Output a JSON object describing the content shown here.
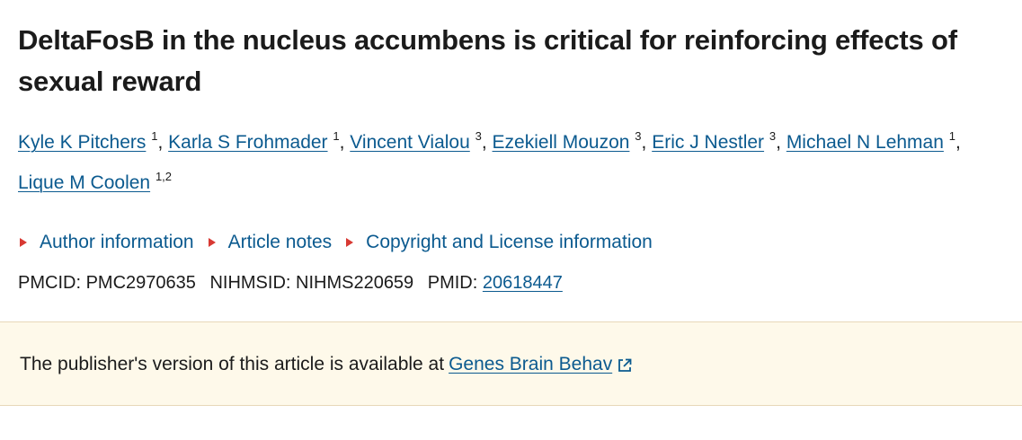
{
  "article": {
    "title": "DeltaFosB in the nucleus accumbens is critical for reinforcing effects of sexual reward"
  },
  "authors": [
    {
      "name": "Kyle K Pitchers",
      "aff": "1",
      "sep": ", "
    },
    {
      "name": "Karla S Frohmader",
      "aff": "1",
      "sep": ", "
    },
    {
      "name": "Vincent Vialou",
      "aff": "3",
      "sep": ", "
    },
    {
      "name": "Ezekiell Mouzon",
      "aff": "3",
      "sep": ", "
    },
    {
      "name": "Eric J Nestler",
      "aff": "3",
      "sep": ", "
    },
    {
      "name": "Michael N Lehman",
      "aff": "1",
      "sep": ","
    },
    {
      "name": "Lique M Coolen",
      "aff": "1,2",
      "sep": ""
    }
  ],
  "toggles": {
    "author_info": "Author information",
    "article_notes": "Article notes",
    "copyright": "Copyright and License information"
  },
  "ids": {
    "pmcid_label": "PMCID:",
    "pmcid_value": "PMC2970635",
    "nihmsid_label": "NIHMSID:",
    "nihmsid_value": "NIHMS220659",
    "pmid_label": "PMID:",
    "pmid_value": "20618447"
  },
  "publisher_banner": {
    "text": "The publisher's version of this article is available at",
    "link": "Genes Brain Behav",
    "icon": "external-link-icon"
  },
  "colors": {
    "link": "#0b5a8f",
    "toggle_arrow": "#d83933",
    "banner_bg": "#fef9ea",
    "text": "#1b1b1b"
  }
}
